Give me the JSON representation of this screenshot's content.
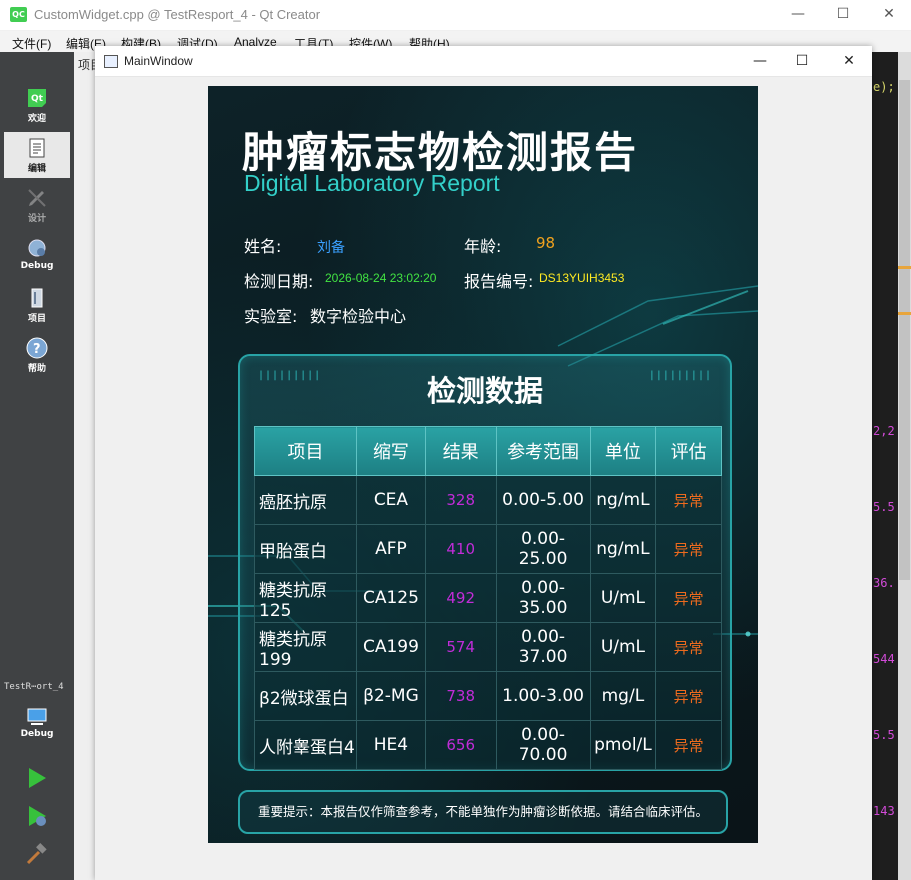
{
  "app": {
    "title": "CustomWidget.cpp @ TestResport_4 - Qt Creator",
    "logo": "QC",
    "menu": [
      "文件(F)",
      "编辑(E)",
      "构建(B)",
      "调试(D)",
      "Analyze",
      "工具(T)",
      "控件(W)",
      "帮助(H)"
    ],
    "sidebar": [
      {
        "label": "欢迎",
        "icon": "qt-logo-icon"
      },
      {
        "label": "编辑",
        "icon": "edit-document-icon"
      },
      {
        "label": "设计",
        "icon": "design-pencil-icon"
      },
      {
        "label": "Debug",
        "icon": "debug-bug-icon"
      },
      {
        "label": "项目",
        "icon": "project-wrench-icon"
      },
      {
        "label": "帮助",
        "icon": "help-question-icon"
      }
    ],
    "project_name": "TestR⋯ort_4",
    "build_kit_label": "Debug",
    "left_strip_label": "项目",
    "code_fragments": [
      "e);",
      "2,2",
      "5.5",
      "36.",
      "544",
      "5.5",
      "143"
    ]
  },
  "main_window": {
    "title": "MainWindow"
  },
  "report": {
    "title": "肿瘤标志物检测报告",
    "subtitle": "Digital Laboratory Report",
    "name_label": "姓名:",
    "name_value": "刘备",
    "age_label": "年龄:",
    "age_value": "98",
    "date_label": "检测日期:",
    "date_value": "2026-08-24 23:02:20",
    "report_id_label": "报告编号:",
    "report_id_value": "DS13YUIH3453",
    "lab_label": "实验室:",
    "lab_value": "数字检验中心",
    "panel_title": "检测数据",
    "table": {
      "headers": [
        "项目",
        "缩写",
        "结果",
        "参考范围",
        "单位",
        "评估"
      ],
      "rows": [
        [
          "癌胚抗原",
          "CEA",
          "328",
          "0.00-5.00",
          "ng/mL",
          "异常"
        ],
        [
          "甲胎蛋白",
          "AFP",
          "410",
          "0.00-25.00",
          "ng/mL",
          "异常"
        ],
        [
          "糖类抗原125",
          "CA125",
          "492",
          "0.00-35.00",
          "U/mL",
          "异常"
        ],
        [
          "糖类抗原199",
          "CA199",
          "574",
          "0.00-37.00",
          "U/mL",
          "异常"
        ],
        [
          "β2微球蛋白",
          "β2-MG",
          "738",
          "1.00-3.00",
          "mg/L",
          "异常"
        ],
        [
          "人附睾蛋白4",
          "HE4",
          "656",
          "0.00-70.00",
          "pmol/L",
          "异常"
        ]
      ]
    },
    "notice": "重要提示：本报告仅作筛查参考，不能单独作为肿瘤诊断依据。请结合临床评估。"
  },
  "colors": {
    "name": "#3aa0ff",
    "age": "#f0a21e",
    "date": "#42e342",
    "report_id": "#ffea22",
    "result": "#c12cd8",
    "evaluation": "#ec6a1e",
    "accent": "#33d0c9"
  }
}
